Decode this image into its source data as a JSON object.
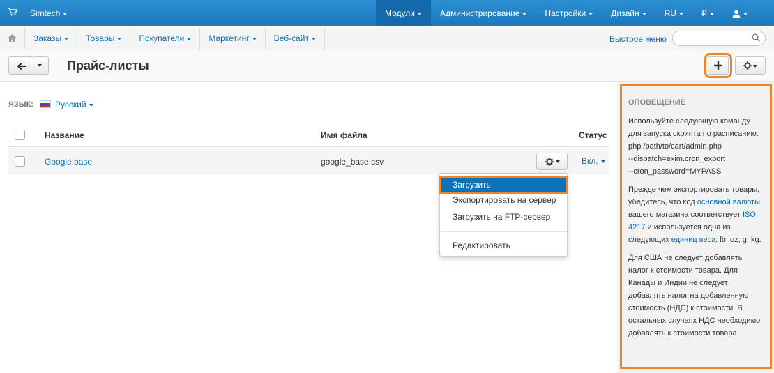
{
  "topbar": {
    "brand": "Simtech",
    "nav": [
      {
        "label": "Модули",
        "active": true
      },
      {
        "label": "Администрирование"
      },
      {
        "label": "Настройки"
      },
      {
        "label": "Дизайн"
      },
      {
        "label": "RU"
      },
      {
        "label": "₽"
      }
    ]
  },
  "subbar": {
    "nav": [
      "Заказы",
      "Товары",
      "Покупатели",
      "Маркетинг",
      "Веб-сайт"
    ],
    "quick_menu": "Быстрое меню",
    "search_placeholder": ""
  },
  "titlebar": {
    "title": "Прайс-листы"
  },
  "language": {
    "label": "ЯЗЫК:",
    "value": "Русский"
  },
  "table": {
    "columns": [
      "Название",
      "Имя файла",
      "Статус"
    ],
    "rows": [
      {
        "name": "Google base",
        "filename": "google_base.csv",
        "status": "Вкл."
      }
    ]
  },
  "row_menu": {
    "items": [
      "Загрузить",
      "Экспортировать на сервер",
      "Загрузить на FTP-сервер",
      "Редактировать"
    ],
    "selected": "Загрузить"
  },
  "notice": {
    "title": "Оповещение",
    "p1": [
      "Используйте следующую команду для запуска скрипта по расписанию:",
      "php /path/to/cart/admin.php",
      "--dispatch=exim.cron_export",
      "--cron_password=MYPASS"
    ],
    "p2": {
      "t1": "Прежде чем экспортировать товары, убедитесь, что код ",
      "link1": "основной валюты",
      "t2": " вашего магазина соответствует ",
      "link2": "ISO 4217",
      "t3": " и используется одна из следующих ",
      "link3": "единиц веса",
      "t4": ": lb, oz, g, kg."
    },
    "p3": "Для США не следует добавлять налог к стоимости товара. Для Канады и Индии не следует добавлять налог на добавленную стоимость (НДС) к стоимости. В остальных случаях НДС необходимо добавлять к стоимости товара."
  },
  "colors": {
    "topbar": "#1d78bd",
    "link": "#0b6fb6",
    "highlight": "#f58220",
    "menu_selected": "#0b73bc"
  }
}
